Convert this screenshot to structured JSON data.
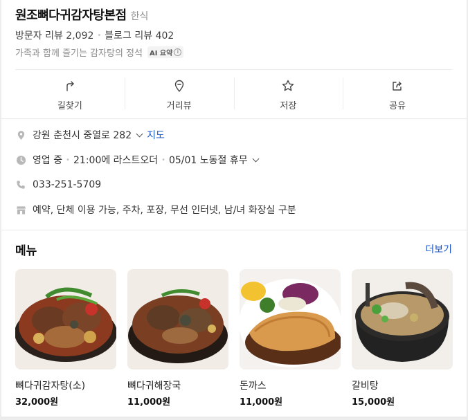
{
  "place": {
    "name": "원조뼈다귀감자탕본점",
    "category": "한식",
    "visitor_reviews": "방문자 리뷰 2,092",
    "blog_reviews": "블로그 리뷰 402",
    "description": "가족과 함께 즐기는 감자탕의 정석",
    "ai_badge": "AI 요약",
    "info_glyph": "i"
  },
  "actions": [
    {
      "label": "길찾기",
      "icon": "directions-icon"
    },
    {
      "label": "거리뷰",
      "icon": "street-view-icon"
    },
    {
      "label": "저장",
      "icon": "star-icon"
    },
    {
      "label": "공유",
      "icon": "share-icon"
    }
  ],
  "info": {
    "address": "강원 춘천시 중열로 282",
    "map_link": "지도",
    "status": "영업 중",
    "last_order": "21:00에 라스트오더",
    "holiday": "05/01 노동절 휴무",
    "phone": "033-251-5709",
    "amenities": "예약, 단체 이용 가능, 주차, 포장, 무선 인터넷, 남/녀 화장실 구분"
  },
  "menu": {
    "title": "메뉴",
    "more": "더보기",
    "items": [
      {
        "name": "뼈다귀감자탕(소)",
        "price": "32,000원"
      },
      {
        "name": "뼈다귀해장국",
        "price": "11,000원"
      },
      {
        "name": "돈까스",
        "price": "11,000원"
      },
      {
        "name": "갈비탕",
        "price": "15,000원"
      }
    ]
  },
  "colors": {
    "link": "#1a56c8",
    "icon_gray": "#555555",
    "muted": "#8f8f8f"
  }
}
